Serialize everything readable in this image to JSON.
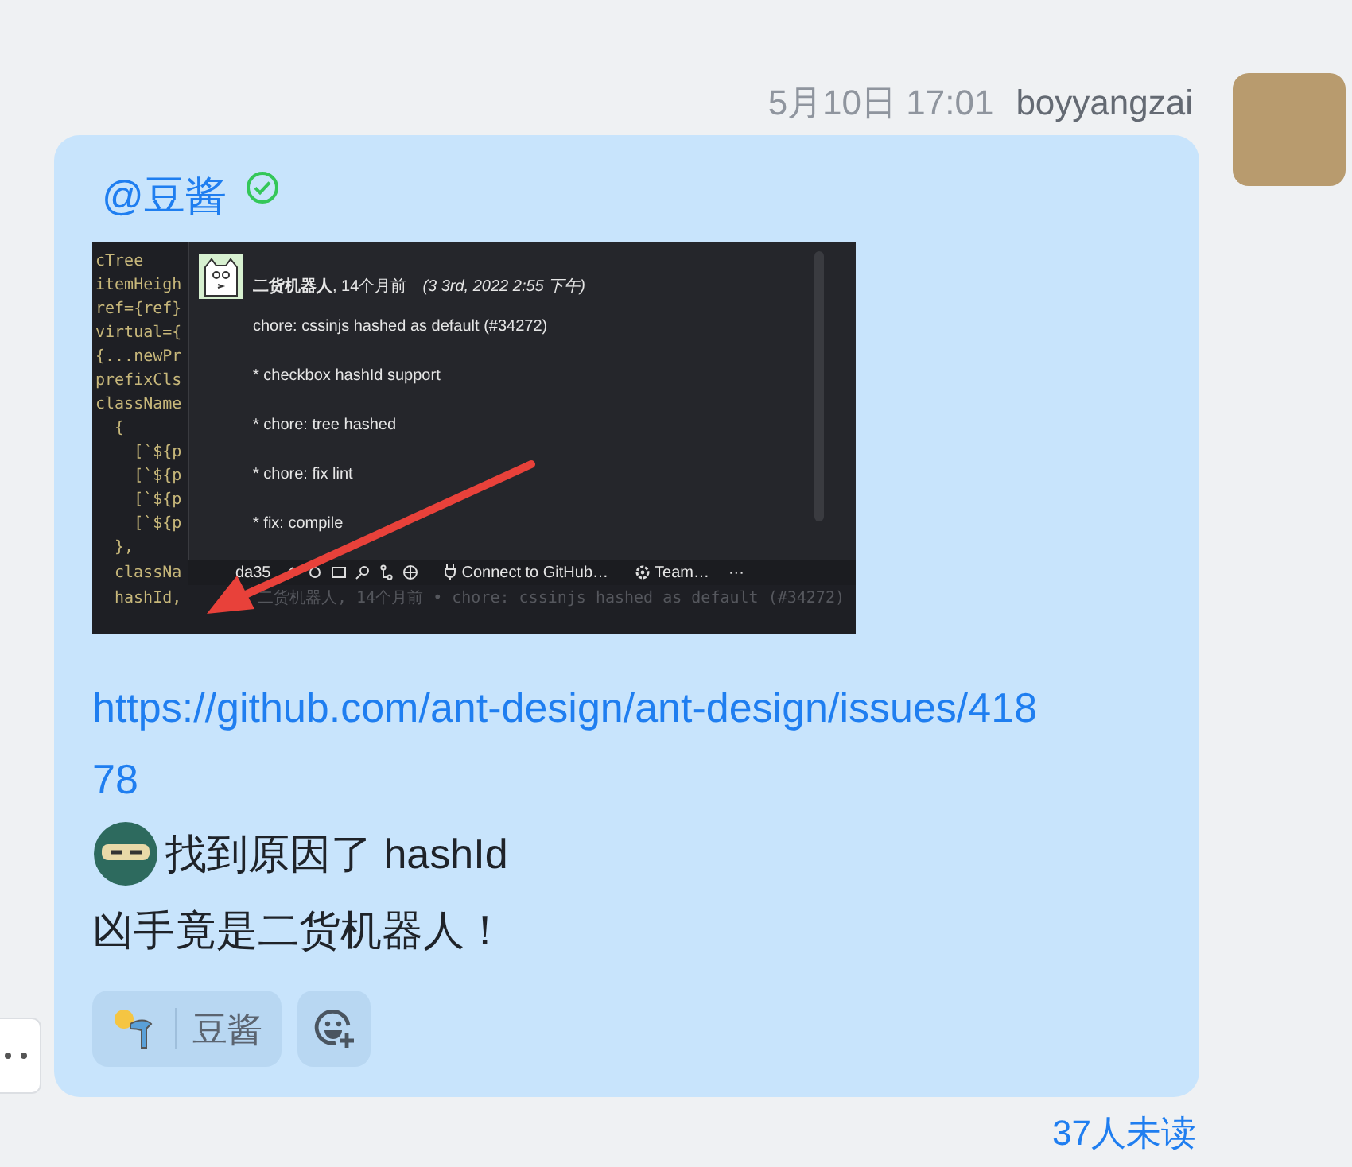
{
  "header": {
    "time": "5月10日 17:01",
    "sender": "boyyangzai"
  },
  "message": {
    "mention": "@豆酱",
    "mention_read": true,
    "screenshot": {
      "code_lines": [
        "cTree",
        "itemHeigh",
        "ref={ref}",
        "virtual={",
        "{...newPr",
        "prefixCls",
        "className",
        "  {",
        "    [`${p",
        "    [`${p",
        "    [`${p",
        "    [`${p",
        "  },"
      ],
      "bottom_code_lines": [
        "classNa",
        "hashId,"
      ],
      "popup": {
        "author": "二货机器人",
        "age": ", 14个月前",
        "date": "(3 3rd, 2022 2:55 下午)",
        "lines": [
          "chore: cssinjs hashed as default (#34272)",
          "* checkbox hashId support",
          "* chore: tree hashed",
          "* chore: fix lint",
          "* fix: compile"
        ]
      },
      "status_bar": {
        "commit": "da35",
        "items": [
          "Connect to GitHub…",
          "Team…"
        ],
        "more": "···"
      },
      "blame": "二货机器人, 14个月前 • chore: cssinjs hashed as default (#34272)"
    },
    "link": "https://github.com/ant-design/ant-design/issues/41878",
    "lines": [
      {
        "kind": "sticker",
        "text": "找到原因了 hashId"
      },
      {
        "kind": "text",
        "text": "凶手竟是二货机器人！"
      }
    ],
    "reactions": [
      {
        "user": "豆酱"
      }
    ]
  },
  "unread": "37人未读"
}
